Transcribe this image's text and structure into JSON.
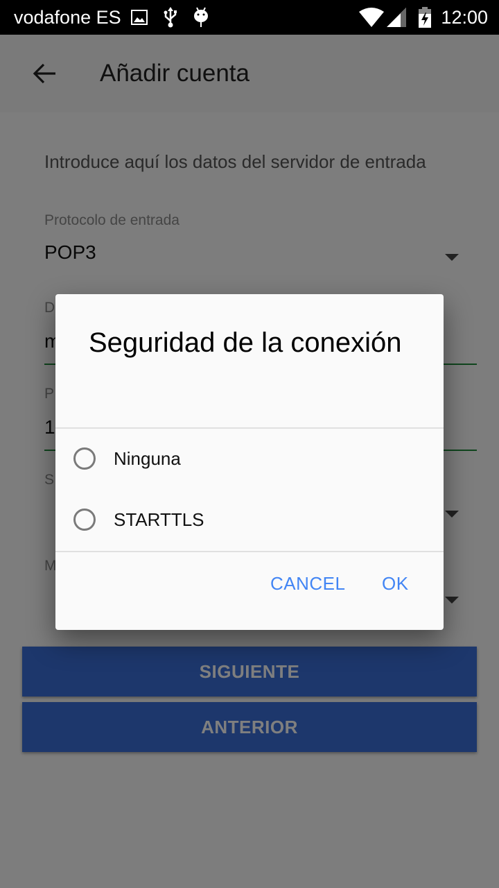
{
  "status_bar": {
    "carrier": "vodafone ES",
    "left_icons": [
      "image-icon",
      "usb-icon",
      "android-debug-icon"
    ],
    "right_icons": [
      "wifi-icon",
      "signal-icon",
      "battery-charging-icon"
    ],
    "time": "12:00"
  },
  "toolbar": {
    "back_icon": "arrow-back-icon",
    "title": "Añadir cuenta"
  },
  "form": {
    "intro": "Introduce aquí los datos del servidor de entrada",
    "fields": [
      {
        "label": "Protocolo de entrada",
        "value": "POP3",
        "type": "dropdown"
      },
      {
        "label": "D",
        "value": "m",
        "type": "text",
        "partially_hidden": true
      },
      {
        "label": "P",
        "value": "1",
        "type": "text",
        "partially_hidden": true
      },
      {
        "label": "S",
        "value": "",
        "type": "dropdown",
        "partially_hidden": true
      },
      {
        "label": "M",
        "value": "",
        "type": "dropdown",
        "partially_hidden": true
      }
    ],
    "next_label": "SIGUIENTE",
    "previous_label": "ANTERIOR"
  },
  "dialog": {
    "title": "Seguridad de la conexión",
    "options": [
      {
        "label": "Ninguna",
        "selected": false
      },
      {
        "label": "STARTTLS",
        "selected": false
      }
    ],
    "cancel_label": "CANCEL",
    "ok_label": "OK"
  },
  "colors": {
    "accent": "#4285f4",
    "primary_button": "#3a6ed8",
    "field_underline": "#1e8b3a"
  }
}
